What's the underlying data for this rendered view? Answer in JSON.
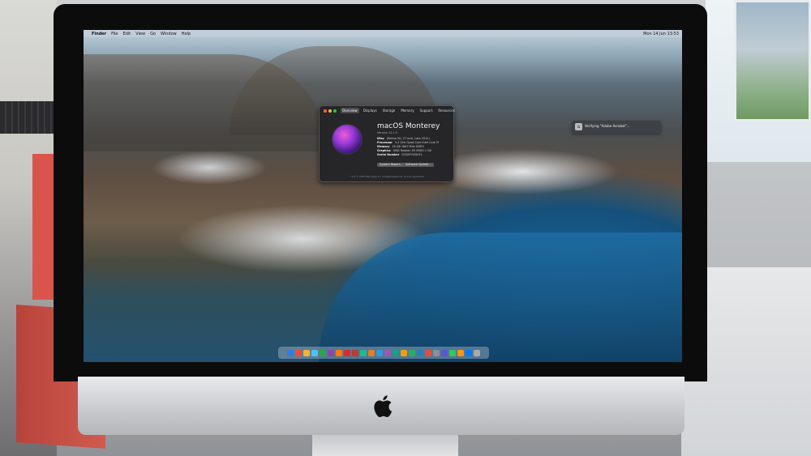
{
  "menubar": {
    "apple_symbol": "",
    "items": [
      "Finder",
      "File",
      "Edit",
      "View",
      "Go",
      "Window",
      "Help"
    ],
    "clock": "Mon 14 Jun 13:53"
  },
  "about_window": {
    "tabs": [
      "Overview",
      "Displays",
      "Storage",
      "Memory",
      "Support",
      "Resources"
    ],
    "os_name": "macOS Monterey",
    "version": "Version 12.1.5",
    "specs": [
      {
        "label": "iMac",
        "value": "(Retina 5K, 27-inch, Late 2015)"
      },
      {
        "label": "Processor",
        "value": "3.2 GHz Quad-Core Intel Core i5"
      },
      {
        "label": "Memory",
        "value": "16 GB 1867 MHz DDR3"
      },
      {
        "label": "Graphics",
        "value": "AMD Radeon R9 M380 2 GB"
      },
      {
        "label": "Serial Number",
        "value": "D25BFVGDGFL"
      }
    ],
    "buttons": [
      "System Report...",
      "Software Update..."
    ],
    "copyright": "™ and © 1983-2022 Apple Inc. All Rights Reserved. License Agreement"
  },
  "notification": {
    "text": "Verifying \"Adobe Acrobat\"..."
  },
  "dock": {
    "icon_colors": [
      "#2f7de1",
      "#e94e3c",
      "#f2b233",
      "#4cc2ff",
      "#2aa64a",
      "#8e44ad",
      "#ff7a00",
      "#d92b2b",
      "#c0392b",
      "#1abc9c",
      "#e67e22",
      "#3498db",
      "#9b59b6",
      "#16a085",
      "#f39c12",
      "#27ae60",
      "#2980b9",
      "#e74c3c",
      "#8e8e93",
      "#5856d6",
      "#34c759",
      "#ff9500",
      "#007aff",
      "#aaaaaa"
    ]
  },
  "hardware": {
    "logo": "apple-logo"
  }
}
